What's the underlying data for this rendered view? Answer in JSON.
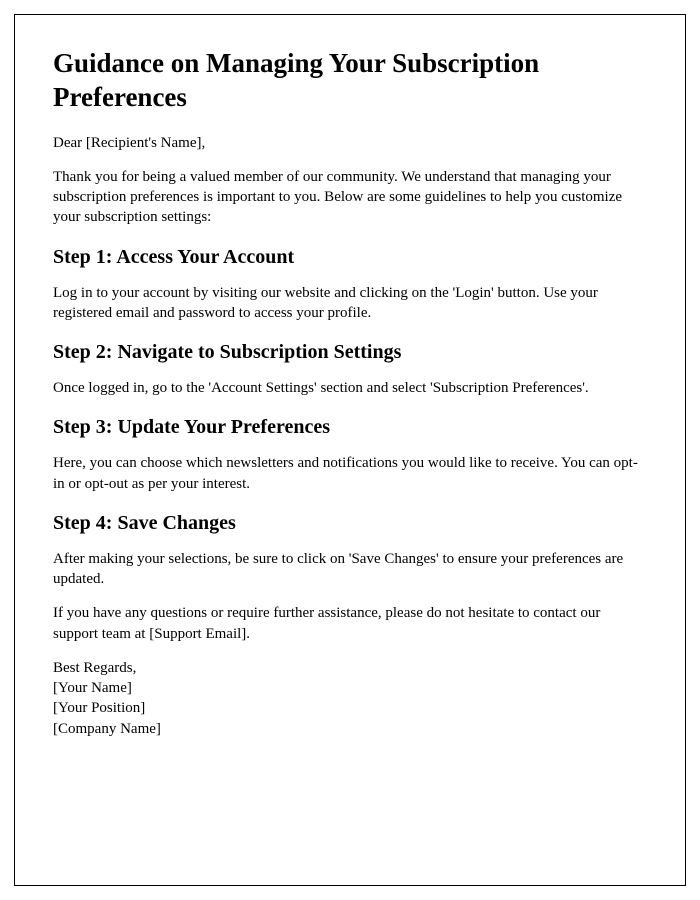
{
  "title": "Guidance on Managing Your Subscription Preferences",
  "salutation": "Dear [Recipient's Name],",
  "intro": "Thank you for being a valued member of our community. We understand that managing your subscription preferences is important to you. Below are some guidelines to help you customize your subscription settings:",
  "steps": {
    "s1": {
      "heading": "Step 1: Access Your Account",
      "body": "Log in to your account by visiting our website and clicking on the 'Login' button. Use your registered email and password to access your profile."
    },
    "s2": {
      "heading": "Step 2: Navigate to Subscription Settings",
      "body": "Once logged in, go to the 'Account Settings' section and select 'Subscription Preferences'."
    },
    "s3": {
      "heading": "Step 3: Update Your Preferences",
      "body": "Here, you can choose which newsletters and notifications you would like to receive. You can opt-in or opt-out as per your interest."
    },
    "s4": {
      "heading": "Step 4: Save Changes",
      "body": "After making your selections, be sure to click on 'Save Changes' to ensure your preferences are updated."
    }
  },
  "support": "If you have any questions or require further assistance, please do not hesitate to contact our support team at [Support Email].",
  "closing": "Best Regards,",
  "signature": {
    "name": "[Your Name]",
    "position": "[Your Position]",
    "company": "[Company Name]"
  }
}
